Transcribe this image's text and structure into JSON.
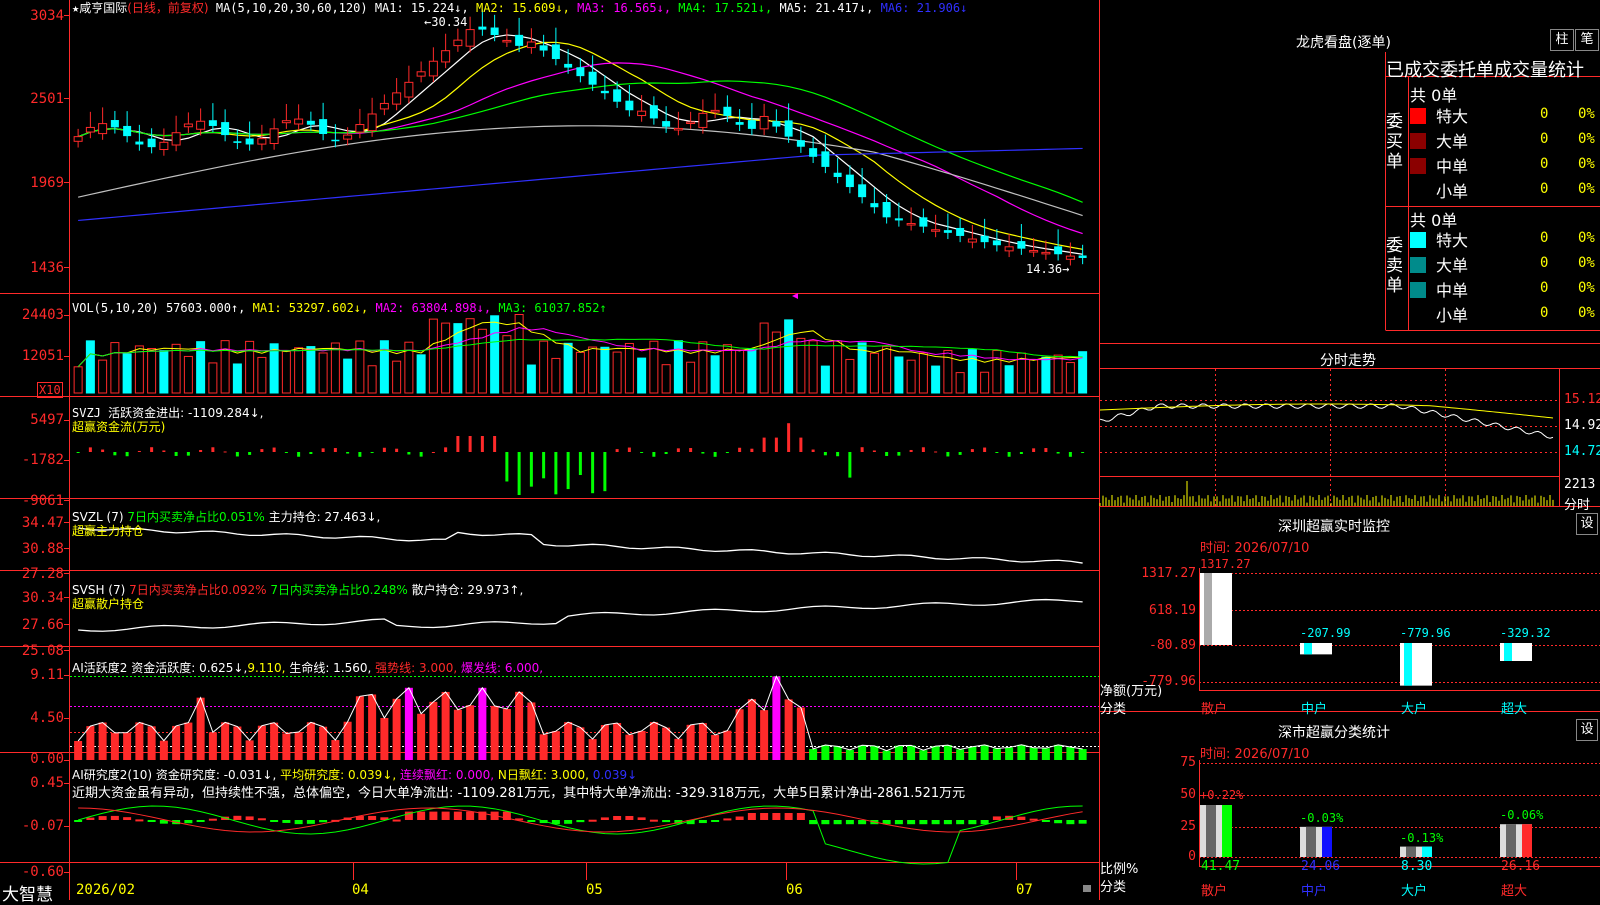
{
  "header": {
    "star": "★",
    "name": "咸亨国际",
    "mode": "(日线，前复权)",
    "ma_label": "MA(5,10,20,30,60,120)",
    "ma1": "MA1: 15.224↓,",
    "ma2": "MA2: 15.609↓,",
    "ma3": "MA3: 16.565↓,",
    "ma4": "MA4: 17.521↓,",
    "ma5": "MA5: 21.417↓,",
    "ma6": "MA6: 21.906↓"
  },
  "price": {
    "ticks": [
      "3034",
      "2501",
      "1969",
      "1436"
    ],
    "high_label": "30.34",
    "low_label": "14.36"
  },
  "vol": {
    "label": "VOL(5,10,20)",
    "value": "57603.000↑,",
    "ma1": "MA1: 53297.602↓,",
    "ma2": "MA2: 63804.898↓,",
    "ma3": "MA3: 61037.852↑",
    "ticks": [
      "24403",
      "12051"
    ],
    "unit": "X10"
  },
  "svzj": {
    "label": "SVZJ",
    "text": "活跃资金进出: -1109.284↓,",
    "sub": "超赢资金流(万元)",
    "ticks": [
      "5497",
      "-1782",
      "-9061"
    ]
  },
  "svzl": {
    "label": "SVZL (7)",
    "t1": "7日内买卖净占比0.051%",
    "t2": "主力持仓: 27.463↓,",
    "sub": "超赢主力持仓",
    "ticks": [
      "34.47",
      "30.88",
      "27.28"
    ]
  },
  "svsh": {
    "label": "SVSH (7)",
    "t1": "7日内买卖净占比0.092%",
    "t2": "7日内买卖净占比0.248%",
    "t3": "散户持仓: 29.973↑,",
    "sub": "超赢散户持仓",
    "ticks": [
      "30.34",
      "27.66",
      "25.08"
    ]
  },
  "ai1": {
    "label": "AI活跃度2",
    "t1": "资金活跃度: 0.625↓,",
    "t2": "9.110,",
    "t3": "生命线: 1.560,",
    "t4": "强势线: 3.000,",
    "t5": "爆发线: 6.000,",
    "ticks": [
      "9.11",
      "4.50",
      "0.00"
    ]
  },
  "ai2": {
    "label": "AI研究度2(10)",
    "t1": "资金研究度: -0.031↓,",
    "t2": "平均研究度: 0.039↓,",
    "t3": "连续飘红: 0.000,",
    "t4": "N日飘红: 3.000,",
    "t5": "0.039↓",
    "comment": "近期大资金虽有异动，但持续性不强，总体偏空，今日大单净流出: -1109.281万元，其中特大单净流出: -329.318万元，大单5日累计净出-2861.521万元",
    "ticks": [
      "0.45",
      "-0.07",
      "-0.60"
    ]
  },
  "xaxis": {
    "brand": "大智慧",
    "labels": [
      "2026/02",
      "04",
      "05",
      "06",
      "07"
    ]
  },
  "lhb": {
    "title": "龙虎看盘(逐单)",
    "btn1": "柱",
    "btn2": "笔",
    "subtitle": "已成交委托单成交量统计",
    "buy": {
      "side": "委买单",
      "total": "共 0单",
      "rows": [
        {
          "name": "特大",
          "v": "0",
          "p": "0%"
        },
        {
          "name": "大单",
          "v": "0",
          "p": "0%"
        },
        {
          "name": "中单",
          "v": "0",
          "p": "0%"
        },
        {
          "name": "小单",
          "v": "0",
          "p": "0%"
        }
      ]
    },
    "sell": {
      "side": "委卖单",
      "total": "共 0单",
      "rows": [
        {
          "name": "特大",
          "v": "0",
          "p": "0%"
        },
        {
          "name": "大单",
          "v": "0",
          "p": "0%"
        },
        {
          "name": "中单",
          "v": "0",
          "p": "0%"
        },
        {
          "name": "小单",
          "v": "0",
          "p": "0%"
        }
      ]
    }
  },
  "fenshi": {
    "title": "分时走势",
    "p1": "15.12",
    "p2": "14.92",
    "p3": "14.72",
    "vol": "2213",
    "unit": "分时"
  },
  "monitor": {
    "title": "深圳超赢实时监控",
    "btn": "设",
    "time": "时间: 2026/07/10",
    "ticks": [
      "1317.27",
      "618.19",
      "-80.89",
      "-779.96"
    ],
    "ylabel": "净额(万元)",
    "xlabel": "分类",
    "bars": [
      {
        "cat": "散户",
        "val": "1317.27"
      },
      {
        "cat": "中户",
        "val": "-207.99"
      },
      {
        "cat": "大户",
        "val": "-779.96"
      },
      {
        "cat": "超大",
        "val": "-329.32"
      }
    ]
  },
  "classify": {
    "title": "深市超赢分类统计",
    "btn": "设",
    "time": "时间: 2026/07/10",
    "ticks": [
      "75",
      "50",
      "25",
      "0"
    ],
    "ylabel": "比例%",
    "xlabel": "分类",
    "bars": [
      {
        "cat": "散户",
        "pct": "+0.22%",
        "val": "41.47"
      },
      {
        "cat": "中户",
        "pct": "-0.03%",
        "val": "24.06"
      },
      {
        "cat": "大户",
        "pct": "-0.13%",
        "val": "8.30"
      },
      {
        "cat": "超大",
        "pct": "-0.06%",
        "val": "26.16"
      }
    ]
  }
}
